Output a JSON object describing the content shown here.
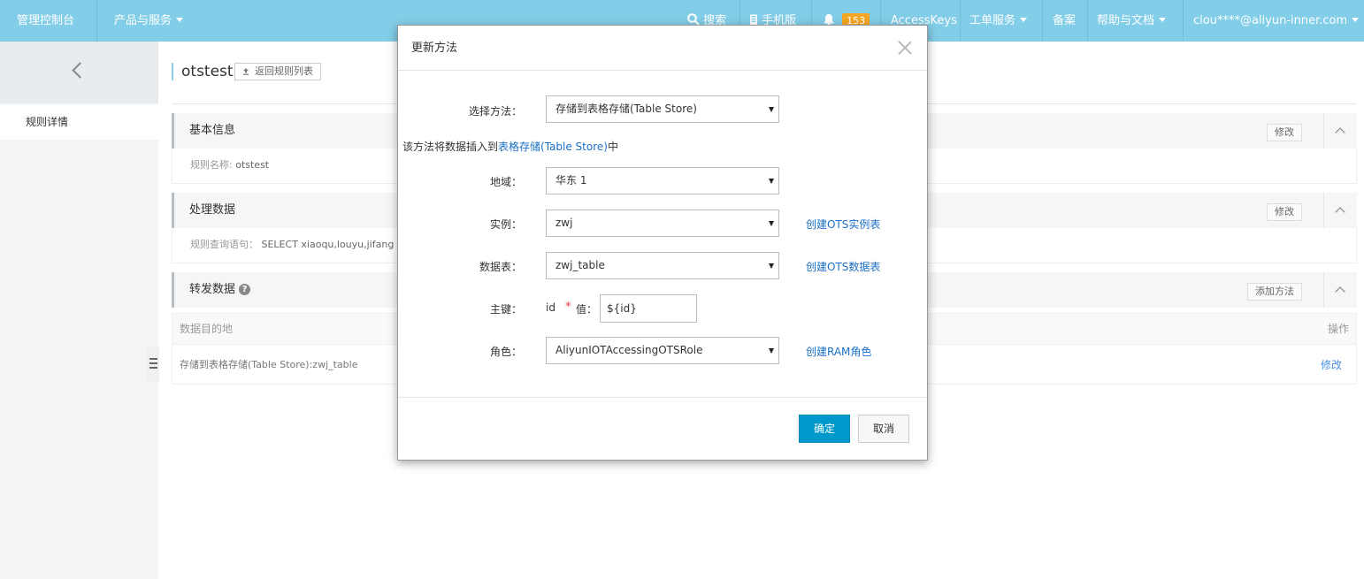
{
  "topbar": {
    "console": "管理控制台",
    "products": "产品与服务",
    "search": "搜索",
    "mobile": "手机版",
    "notifications_count": "153",
    "access_keys": "AccessKeys",
    "tickets": "工单服务",
    "filing": "备案",
    "help": "帮助与文档",
    "account": "clou****@aliyun-inner.com"
  },
  "sidebar": {
    "items": [
      {
        "label": "规则详情"
      }
    ]
  },
  "page": {
    "title": "otstest",
    "back_label": "返回规则列表"
  },
  "panels": {
    "basic": {
      "title": "基本信息",
      "edit_label": "修改",
      "field_label": "规则名称:",
      "field_value": "otstest"
    },
    "process": {
      "title": "处理数据",
      "edit_label": "修改",
      "field_label": "规则查询语句：",
      "field_value": "SELECT xiaoqu,louyu,jifang"
    },
    "forward": {
      "title": "转发数据",
      "add_label": "添加方法",
      "table": {
        "headers": [
          "数据目的地",
          "操作"
        ],
        "rows": [
          {
            "destination": "存储到表格存储(Table Store):zwj_table",
            "action": "修改"
          }
        ]
      }
    }
  },
  "modal": {
    "title": "更新方法",
    "method_label": "选择方法：",
    "method_value": "存储到表格存储(Table Store)",
    "desc_prefix": "该方法将数据插入到",
    "desc_link": "表格存储(Table Store)",
    "desc_suffix": "中",
    "region_label": "地域：",
    "region_value": "华东 1",
    "instance_label": "实例：",
    "instance_value": "zwj",
    "instance_link": "创建OTS实例表",
    "table_label": "数据表：",
    "table_value": "zwj_table",
    "table_link": "创建OTS数据表",
    "pk_label": "主键：",
    "pk_key": "id",
    "pk_value_label": "值：",
    "pk_value": "${id}",
    "role_label": "角色：",
    "role_value": "AliyunIOTAccessingOTSRole",
    "role_link": "创建RAM角色",
    "ok_label": "确定",
    "cancel_label": "取消"
  }
}
